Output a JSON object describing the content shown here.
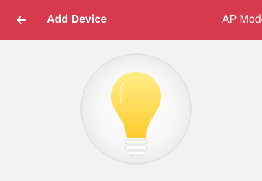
{
  "app_bar": {
    "background": "#d63a4c",
    "back_icon": "arrow-left-icon",
    "title": "Add Device",
    "mode_label": "AP Mode"
  },
  "content": {
    "background": "#f2f2f2",
    "illustration_icon": "light-bulb-icon",
    "bulb_color": "#ffd83d"
  }
}
